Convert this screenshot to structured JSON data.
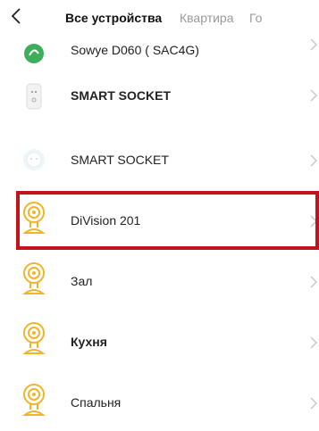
{
  "header": {
    "tabs": [
      {
        "label": "Все устройства",
        "active": true
      },
      {
        "label": "Квартира",
        "active": false
      },
      {
        "label": "Го",
        "active": false
      }
    ]
  },
  "devices": [
    {
      "label": "Sowye D060 ( SAC4G)",
      "icon": "plant-sensor-icon",
      "bold": false
    },
    {
      "label": "SMART SOCKET",
      "icon": "smart-socket-icon",
      "bold": true
    },
    {
      "label": "SMART SOCKET",
      "icon": "smart-socket-round-icon",
      "bold": false
    },
    {
      "label": "DiVision 201",
      "icon": "camera-icon",
      "bold": false,
      "highlighted": true
    },
    {
      "label": "Зал",
      "icon": "camera-icon",
      "bold": false
    },
    {
      "label": "Кухня",
      "icon": "camera-icon",
      "bold": true
    },
    {
      "label": "Спальня",
      "icon": "camera-icon",
      "bold": false
    }
  ],
  "colors": {
    "highlight_border": "#c4121a",
    "camera_icon": "#f0b429",
    "chevron": "#c8c8c8"
  }
}
